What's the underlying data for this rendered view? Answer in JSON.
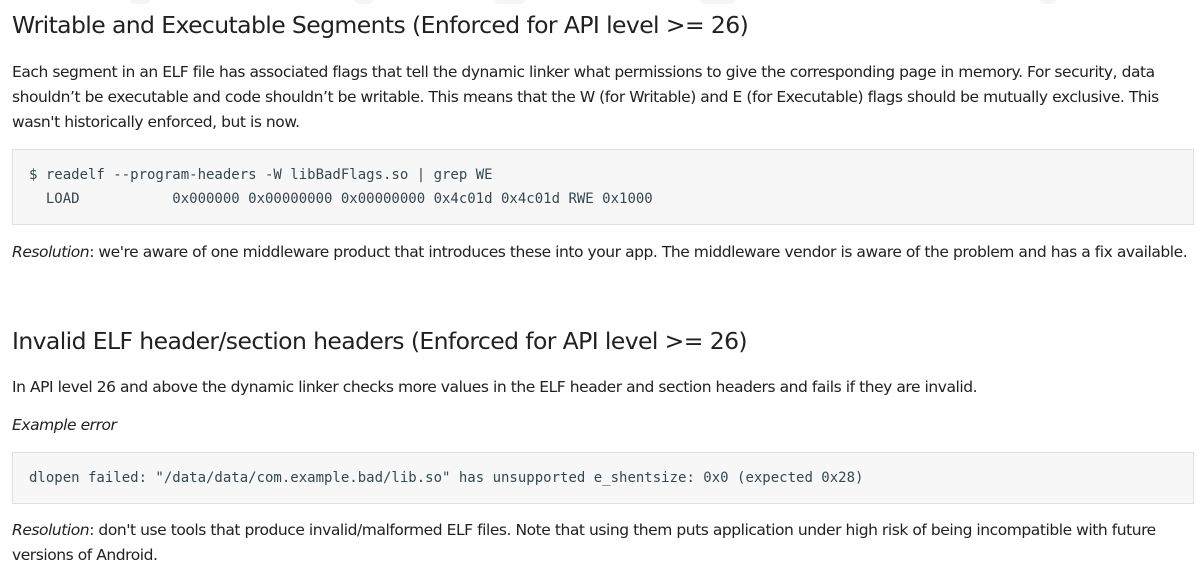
{
  "section_writable": {
    "heading": "Writable and Executable Segments (Enforced for API level >= 26)",
    "paragraph": "Each segment in an ELF file has associated flags that tell the dynamic linker what permissions to give the corresponding page in memory. For security, data shouldn’t be executable and code shouldn’t be writable. This means that the W (for Writable) and E (for Executable) flags should be mutually exclusive. This wasn't historically enforced, but is now.",
    "code_lines": [
      "$ readelf --program-headers -W libBadFlags.so | grep WE",
      "  LOAD           0x000000 0x00000000 0x00000000 0x4c01d 0x4c01d RWE 0x1000"
    ],
    "resolution_label": "Resolution",
    "resolution_text": ": we're aware of one middleware product that introduces these into your app. The middleware vendor is aware of the problem and has a fix available."
  },
  "section_invalid": {
    "heading": "Invalid ELF header/section headers (Enforced for API level >= 26)",
    "paragraph": "In API level 26 and above the dynamic linker checks more values in the ELF header and section headers and fails if they are invalid.",
    "example_label": "Example error",
    "code_lines": [
      "dlopen failed: \"/data/data/com.example.bad/lib.so\" has unsupported e_shentsize: 0x0 (expected 0x28)"
    ],
    "resolution_label": "Resolution",
    "resolution_text": ": don't use tools that produce invalid/malformed ELF files. Note that using them puts application under high risk of being incompatible with future versions of Android."
  }
}
